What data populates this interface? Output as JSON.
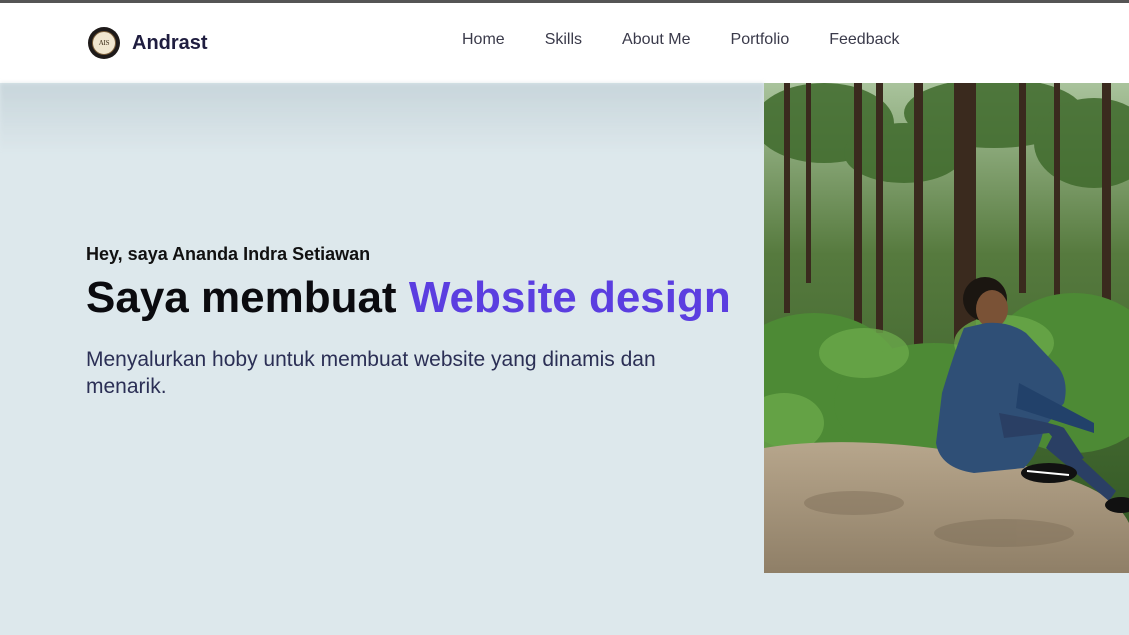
{
  "brand": {
    "name": "Andrast",
    "logo_text": "AIS"
  },
  "nav": {
    "items": [
      {
        "label": "Home"
      },
      {
        "label": "Skills"
      },
      {
        "label": "About Me"
      },
      {
        "label": "Portfolio"
      },
      {
        "label": "Feedback"
      }
    ]
  },
  "hero": {
    "greeting": "Hey, saya Ananda Indra Setiawan",
    "headline_prefix": "Saya membuat ",
    "headline_accent": "Website design",
    "subtitle": "Menyalurkan hoby untuk membuat website yang dinamis dan menarik."
  },
  "colors": {
    "accent": "#5b3ee0",
    "background": "#dde8ec",
    "header_bg": "#ffffff",
    "brand_text": "#1f1d3f"
  }
}
